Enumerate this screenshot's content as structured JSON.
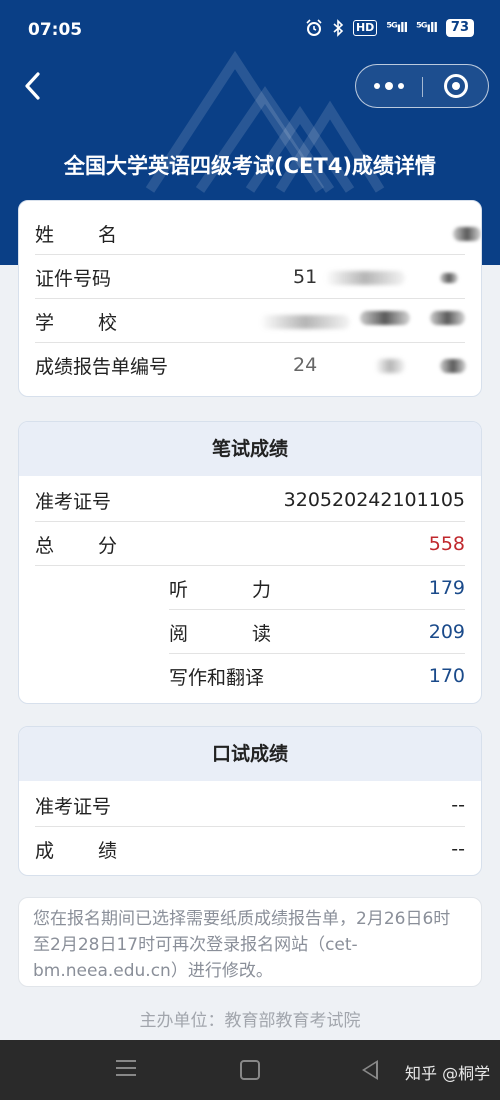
{
  "status": {
    "time": "07:05",
    "hd_label": "HD",
    "sig1": "⁵ᴳıll",
    "sig2": "⁵ᴳıll",
    "battery": "73"
  },
  "header": {
    "title": "全国大学英语四级考试(CET4)成绩详情"
  },
  "info": {
    "name_label": [
      "姓",
      "名"
    ],
    "id_label": "证件号码",
    "id_value": "51",
    "school_label": [
      "学",
      "校"
    ],
    "report_label": "成绩报告单编号",
    "report_value": "24"
  },
  "written": {
    "heading": "笔试成绩",
    "ticket_label": "准考证号",
    "ticket_value": "320520242101105",
    "total_label": [
      "总",
      "分"
    ],
    "total_value": "558",
    "listening_label": [
      "听",
      "力"
    ],
    "listening_value": "179",
    "reading_label": [
      "阅",
      "读"
    ],
    "reading_value": "209",
    "writing_label": "写作和翻译",
    "writing_value": "170"
  },
  "oral": {
    "heading": "口试成绩",
    "ticket_label": "准考证号",
    "ticket_value": "--",
    "score_label": [
      "成",
      "绩"
    ],
    "score_value": "--"
  },
  "notice": "您在报名期间已选择需要纸质成绩报告单，2月26日6时至2月28日17时可再次登录报名网站（cet-bm.neea.edu.cn）进行修改。",
  "footer": "主办单位：教育部教育考试院",
  "watermark": "知乎 @桐学",
  "colors": {
    "header_bg": "#0a3f86",
    "total_score": "#c0282d",
    "score_text": "#1a4a8a"
  }
}
